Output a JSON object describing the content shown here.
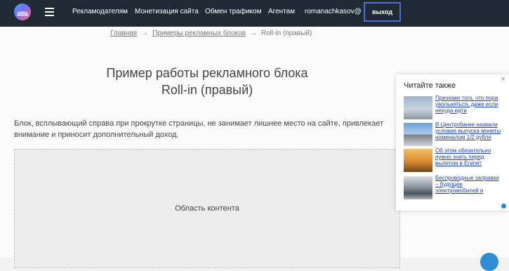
{
  "nav": {
    "items": [
      "Рекламодателям",
      "Монетизация сайта",
      "Обмен трафиком",
      "Агентам"
    ],
    "user": "romanachkasov@",
    "logout_label": "выход"
  },
  "breadcrumbs": {
    "home": "Главная",
    "section": "Примеры рекламных блоков",
    "current": "Roll-in (правый)",
    "separator": "→"
  },
  "page": {
    "title_line1": "Пример работы рекламного блока",
    "title_line2": "Roll-in (правый)",
    "description": "Блок, всплывающий справа при прокрутке страницы, не занимает лишнее место на сайте, привлекает внимание и приносит дополнительный доход.",
    "content_area_label": "Область контента"
  },
  "widget": {
    "title": "Читайте также",
    "close_glyph": "×",
    "items": [
      {
        "text": "Признаки того, что пора увольняться, даже если некуда идти"
      },
      {
        "text": "В Центробанке назвали условие выпуска монеты номиналом 1/2 рубля"
      },
      {
        "text": "Об этом обязательно нужно знать перед вылетом в Египет"
      },
      {
        "text": "Беспроводные заправки – будущее электромобилей и"
      }
    ]
  },
  "colors": {
    "topbar": "#1f2a35",
    "accent_border": "#4f6fd8",
    "link": "#1a3fb5"
  }
}
